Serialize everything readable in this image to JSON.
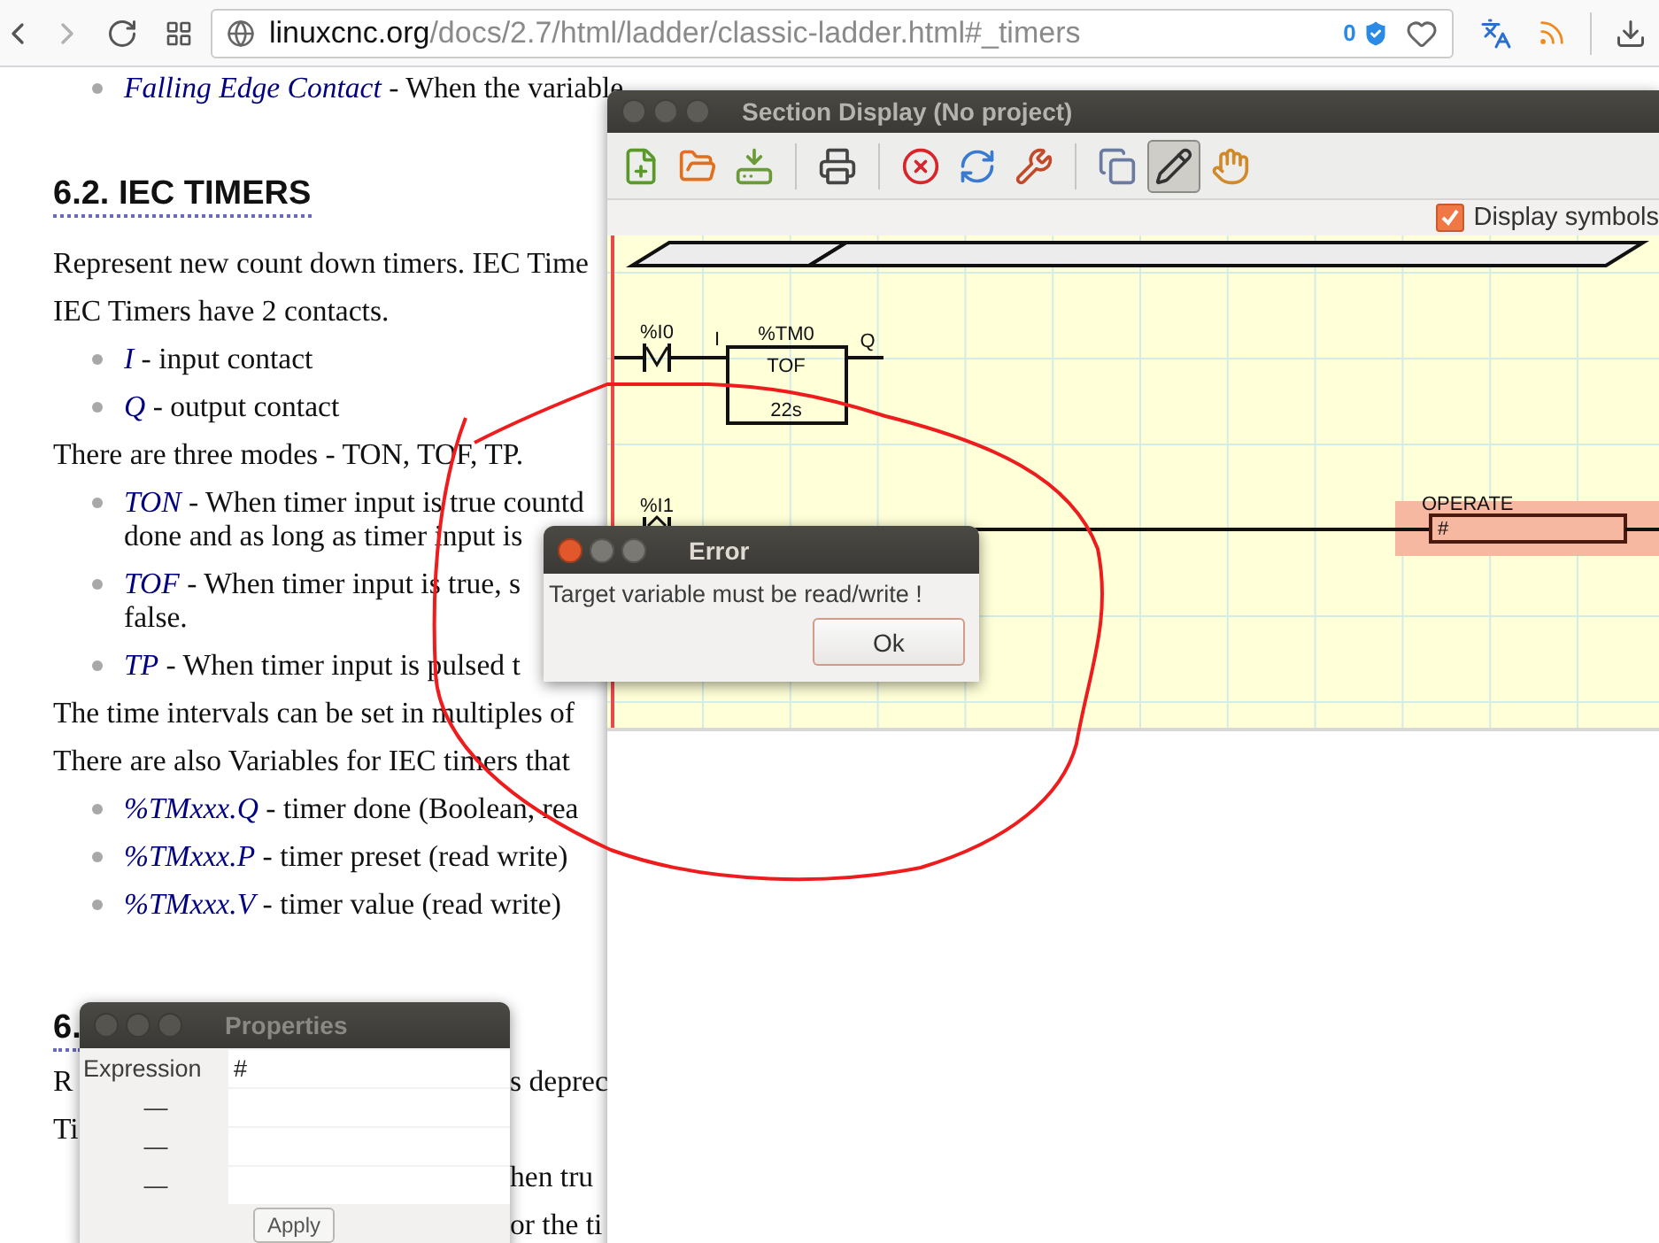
{
  "browser": {
    "url_host": "linuxcnc.org",
    "url_path": "/docs/2.7/html/ladder/classic-ladder.html#_timers",
    "tracker_count": "0"
  },
  "page": [
    {
      "kind": "bullet",
      "term": "Falling Edge Contact",
      "text": "- When the variable"
    },
    {
      "kind": "heading",
      "text": "6.2. IEC TIMERS"
    },
    {
      "kind": "para",
      "text": "Represent new count down timers. IEC Time"
    },
    {
      "kind": "para",
      "text": "IEC Timers have 2 contacts."
    },
    {
      "kind": "bullet",
      "term": "I",
      "text": "- input contact"
    },
    {
      "kind": "bullet",
      "term": "Q",
      "text": "- output contact"
    },
    {
      "kind": "para",
      "text": "There are three modes - TON, TOF, TP."
    },
    {
      "kind": "bullet",
      "term": "TON",
      "text": "- When timer input is true countd",
      "continuation": "done and as long as timer input is"
    },
    {
      "kind": "bullet",
      "term": "TOF",
      "text": "- When timer input is true, s",
      "continuation": "false."
    },
    {
      "kind": "bullet",
      "term": "TP",
      "text": "- When timer input is pulsed t"
    },
    {
      "kind": "para",
      "text": "The time intervals can be set in multiples of"
    },
    {
      "kind": "para",
      "text": "There are also Variables for IEC timers that"
    },
    {
      "kind": "bullet",
      "term": "%TMxxx.Q",
      "text": "- timer done (Boolean, rea"
    },
    {
      "kind": "bullet",
      "term": "%TMxxx.P",
      "text": "- timer preset (read write)"
    },
    {
      "kind": "bullet",
      "term": "%TMxxx.V",
      "text": "- timer value (read write)"
    },
    {
      "kind": "heading",
      "text": "6."
    },
    {
      "kind": "split",
      "left": "R",
      "right": "s deprec"
    },
    {
      "kind": "split",
      "left": "Ti"
    },
    {
      "kind": "split",
      "right": "hen tru"
    },
    {
      "kind": "split",
      "right": "or the ti"
    }
  ],
  "section_window": {
    "title": "Section Display (No project)",
    "tools": [
      {
        "kind": "new",
        "pressed": false
      },
      {
        "kind": "open",
        "pressed": false
      },
      {
        "kind": "save",
        "pressed": false
      },
      {
        "kind": "separator"
      },
      {
        "kind": "print",
        "pressed": false
      },
      {
        "kind": "separator"
      },
      {
        "kind": "delete",
        "pressed": false
      },
      {
        "kind": "refresh",
        "pressed": false
      },
      {
        "kind": "settings",
        "pressed": false
      },
      {
        "kind": "separator"
      },
      {
        "kind": "copy",
        "pressed": false
      },
      {
        "kind": "edit",
        "pressed": true
      },
      {
        "kind": "hand",
        "pressed": false
      }
    ],
    "display_symbols": {
      "label": "Display symbols",
      "checked": true
    },
    "ladder": {
      "rung_1": {
        "contact": "%I0",
        "input": "I",
        "timer": "%TM0",
        "mode": "TOF",
        "preset": "22s",
        "output": "Q"
      },
      "rung_2": {
        "contact": "%I1",
        "block_label": "OPERATE",
        "expression": "#",
        "selected": true
      }
    }
  },
  "error_dialog": {
    "title": "Error",
    "message": "Target variable must be read/write !",
    "button": "Ok"
  },
  "properties": {
    "title": "Properties",
    "rows": [
      {
        "label": "Expression",
        "value": "#"
      },
      {
        "label": "—"
      },
      {
        "label": "—"
      },
      {
        "label": "—"
      }
    ],
    "button": "Apply"
  }
}
